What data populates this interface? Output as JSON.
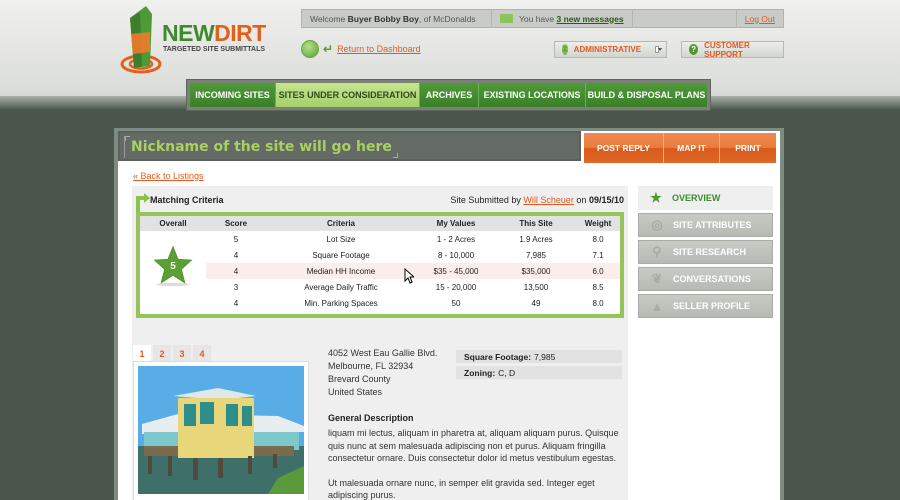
{
  "brand": {
    "name_part1": "NEW",
    "name_part2": "DIRT",
    "tagline": "TARGETED SITE SUBMITTALS",
    "colors": {
      "green": "#3f8a2e",
      "orange": "#e2601e"
    }
  },
  "welcome": {
    "prefix": "Welcome",
    "user": "Buyer Bobby Boy",
    "suffix": ", of McDonalds",
    "messages_prefix": "You have",
    "messages_link": "3 new messages",
    "logout": "Log Out"
  },
  "dashboard_link": "Return to Dashboard",
  "top_buttons": {
    "administrative": "ADMINISTRATIVE",
    "support": "CUSTOMER SUPPORT"
  },
  "nav": {
    "tabs": [
      {
        "label": "INCOMING SITES",
        "active": false
      },
      {
        "label": "SITES UNDER CONSIDERATION",
        "active": true
      },
      {
        "label": "ARCHIVES",
        "active": false
      },
      {
        "label": "EXISTING LOCATIONS",
        "active": false
      },
      {
        "label": "BUILD & DISPOSAL PLANS",
        "active": false
      }
    ]
  },
  "site": {
    "nickname": "Nickname of the site will go here",
    "actions": [
      "POST REPLY",
      "MAP IT",
      "PRINT"
    ],
    "back_link": "« Back to Listings",
    "matching": {
      "title": "Matching Criteria",
      "submitted_prefix": "Site Submitted by",
      "submitted_by": "Will Scheuer",
      "submitted_on_prefix": "on",
      "submitted_date": "09/15/10",
      "headers": [
        "Overall",
        "Score",
        "Criteria",
        "My Values",
        "This Site",
        "Weight"
      ],
      "overall": "5",
      "rows": [
        {
          "score": "5",
          "criteria": "Lot Size",
          "my_values": "1 - 2 Acres",
          "this_site": "1.9 Acres",
          "weight": "8.0"
        },
        {
          "score": "4",
          "criteria": "Square Footage",
          "my_values": "8 - 10,000",
          "this_site": "7,985",
          "weight": "7.1"
        },
        {
          "score": "4",
          "criteria": "Median HH Income",
          "my_values": "$35 - 45,000",
          "this_site": "$35,000",
          "weight": "6.0"
        },
        {
          "score": "3",
          "criteria": "Average Daily Traffic",
          "my_values": "15 - 20,000",
          "this_site": "13,500",
          "weight": "8.5"
        },
        {
          "score": "4",
          "criteria": "Min. Parking Spaces",
          "my_values": "50",
          "this_site": "49",
          "weight": "8.0"
        }
      ]
    },
    "photo_tabs": [
      "1",
      "2",
      "3",
      "4"
    ],
    "address": [
      "4052 West Eau Gallie Blvd.",
      "Melbourne, FL 32934",
      "Brevard County",
      "United States"
    ],
    "props": [
      {
        "label": "Square Footage:",
        "value": "7,985"
      },
      {
        "label": "Zoning:",
        "value": "C, D"
      }
    ],
    "description_title": "General Description",
    "description_p1": "liquam mi lectus, aliquam in pharetra at, aliquam aliquam purus. Quisque quis nunc at sem malesuada adipiscing non et purus. Aliquam fringilla consectetur ornare. Duis consectetur dolor id metus vestibulum egestas.",
    "description_p2": "Ut malesuada ornare nunc, in semper elit gravida sed. Integer eget adipiscing purus."
  },
  "side_menu": [
    {
      "label": "OVERVIEW",
      "icon": "star-icon",
      "active": true
    },
    {
      "label": "SITE ATTRIBUTES",
      "icon": "target-icon",
      "active": false
    },
    {
      "label": "SITE RESEARCH",
      "icon": "magnifier-icon",
      "active": false
    },
    {
      "label": "CONVERSATIONS",
      "icon": "speech-bubbles-icon",
      "active": false
    },
    {
      "label": "SELLER PROFILE",
      "icon": "person-icon",
      "active": false
    }
  ]
}
